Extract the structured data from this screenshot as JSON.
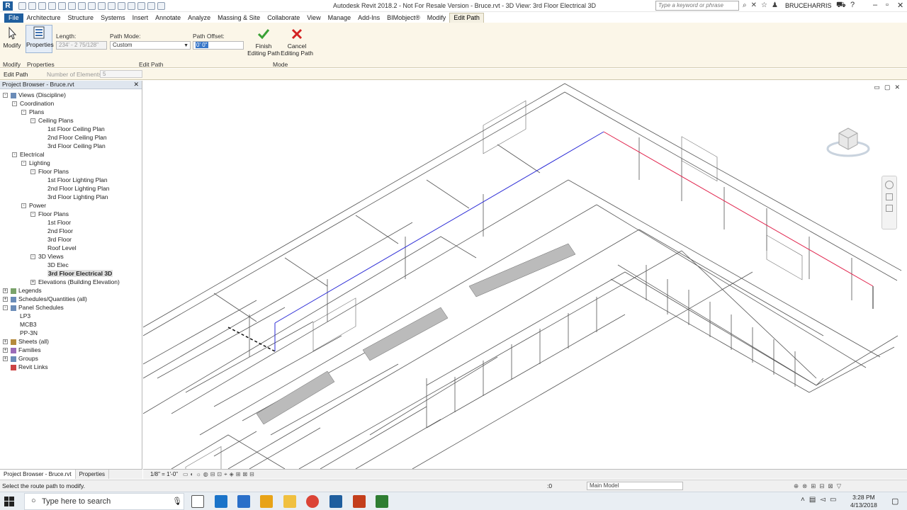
{
  "app": {
    "logo_letter": "R",
    "title": "Autodesk Revit 2018.2 - Not For Resale Version -    Bruce.rvt - 3D View: 3rd Floor Electrical 3D",
    "search_placeholder": "Type a keyword or phrase",
    "user": "BRUCEHARRIS"
  },
  "tabs": [
    "File",
    "Architecture",
    "Structure",
    "Systems",
    "Insert",
    "Annotate",
    "Analyze",
    "Massing & Site",
    "Collaborate",
    "View",
    "Manage",
    "Add-Ins",
    "BIMobject®",
    "Modify",
    "Edit Path"
  ],
  "active_tab": "Edit Path",
  "ribbon": {
    "modify_label": "Modify",
    "properties_label": "Properties",
    "length_label": "Length:",
    "length_value": "234' - 2 75/128\"",
    "path_mode_label": "Path Mode:",
    "path_mode_value": "Custom",
    "path_offset_label": "Path Offset:",
    "path_offset_value": "0' 0\"",
    "finish_label_1": "Finish",
    "finish_label_2": "Editing Path",
    "cancel_label_1": "Cancel",
    "cancel_label_2": "Editing Path",
    "panel_modify": "Modify",
    "panel_properties": "Properties",
    "panel_edit_path": "Edit Path",
    "panel_mode": "Mode"
  },
  "options_bar": {
    "context": "Edit Path",
    "num_elements_label": "Number of Elements:",
    "num_elements_value": "5"
  },
  "browser": {
    "title": "Project Browser - Bruce.rvt",
    "tree": [
      {
        "label": "Views (Discipline)",
        "level": 0,
        "toggle": "-",
        "icon": "views"
      },
      {
        "label": "Coordination",
        "level": 1,
        "toggle": "-"
      },
      {
        "label": "Plans",
        "level": 2,
        "toggle": "-"
      },
      {
        "label": "Ceiling Plans",
        "level": 3,
        "toggle": "-"
      },
      {
        "label": "1st Floor Ceiling Plan",
        "level": 4
      },
      {
        "label": "2nd Floor Ceiling Plan",
        "level": 4
      },
      {
        "label": "3rd Floor Ceiling Plan",
        "level": 4
      },
      {
        "label": "Electrical",
        "level": 1,
        "toggle": "-"
      },
      {
        "label": "Lighting",
        "level": 2,
        "toggle": "-"
      },
      {
        "label": "Floor Plans",
        "level": 3,
        "toggle": "-"
      },
      {
        "label": "1st Floor Lighting Plan",
        "level": 4
      },
      {
        "label": "2nd Floor Lighting Plan",
        "level": 4
      },
      {
        "label": "3rd Floor Lighting Plan",
        "level": 4
      },
      {
        "label": "Power",
        "level": 2,
        "toggle": "-"
      },
      {
        "label": "Floor Plans",
        "level": 3,
        "toggle": "-"
      },
      {
        "label": "1st Floor",
        "level": 4
      },
      {
        "label": "2nd Floor",
        "level": 4
      },
      {
        "label": "3rd Floor",
        "level": 4
      },
      {
        "label": "Roof Level",
        "level": 4
      },
      {
        "label": "3D Views",
        "level": 3,
        "toggle": "-"
      },
      {
        "label": "3D Elec",
        "level": 4
      },
      {
        "label": "3rd Floor Electrical 3D",
        "level": 4,
        "selected": true
      },
      {
        "label": "Elevations (Building Elevation)",
        "level": 3,
        "toggle": "+"
      },
      {
        "label": "Legends",
        "level": 0,
        "toggle": "+",
        "icon": "legend"
      },
      {
        "label": "Schedules/Quantities (all)",
        "level": 0,
        "toggle": "+",
        "icon": "schedule"
      },
      {
        "label": "Panel Schedules",
        "level": 0,
        "toggle": "-",
        "icon": "schedule"
      },
      {
        "label": "LP3",
        "level": 1
      },
      {
        "label": "MCB3",
        "level": 1
      },
      {
        "label": "PP-3N",
        "level": 1
      },
      {
        "label": "Sheets (all)",
        "level": 0,
        "toggle": "+",
        "icon": "sheet"
      },
      {
        "label": "Families",
        "level": 0,
        "toggle": "+",
        "icon": "family"
      },
      {
        "label": "Groups",
        "level": 0,
        "toggle": "+",
        "icon": "group"
      },
      {
        "label": "Revit Links",
        "level": 0,
        "icon": "link"
      }
    ],
    "bottom_tabs": [
      "Project Browser - Bruce.rvt",
      "Properties"
    ]
  },
  "viewport": {
    "scale": "1/8\" = 1'-0\""
  },
  "status": {
    "text": "Select the route path to modify.",
    "zero": ":0",
    "model": "Main Model"
  },
  "taskbar": {
    "search_text": "Type here to search",
    "time": "3:28 PM",
    "date": "4/13/2018"
  },
  "colors": {
    "file_tab": "#1f5e9e",
    "ribbon_bg": "#fbf6e8",
    "path_blue": "#2b2bd6",
    "path_red": "#e0204a",
    "finish_green": "#3aa136",
    "cancel_red": "#d42222"
  }
}
